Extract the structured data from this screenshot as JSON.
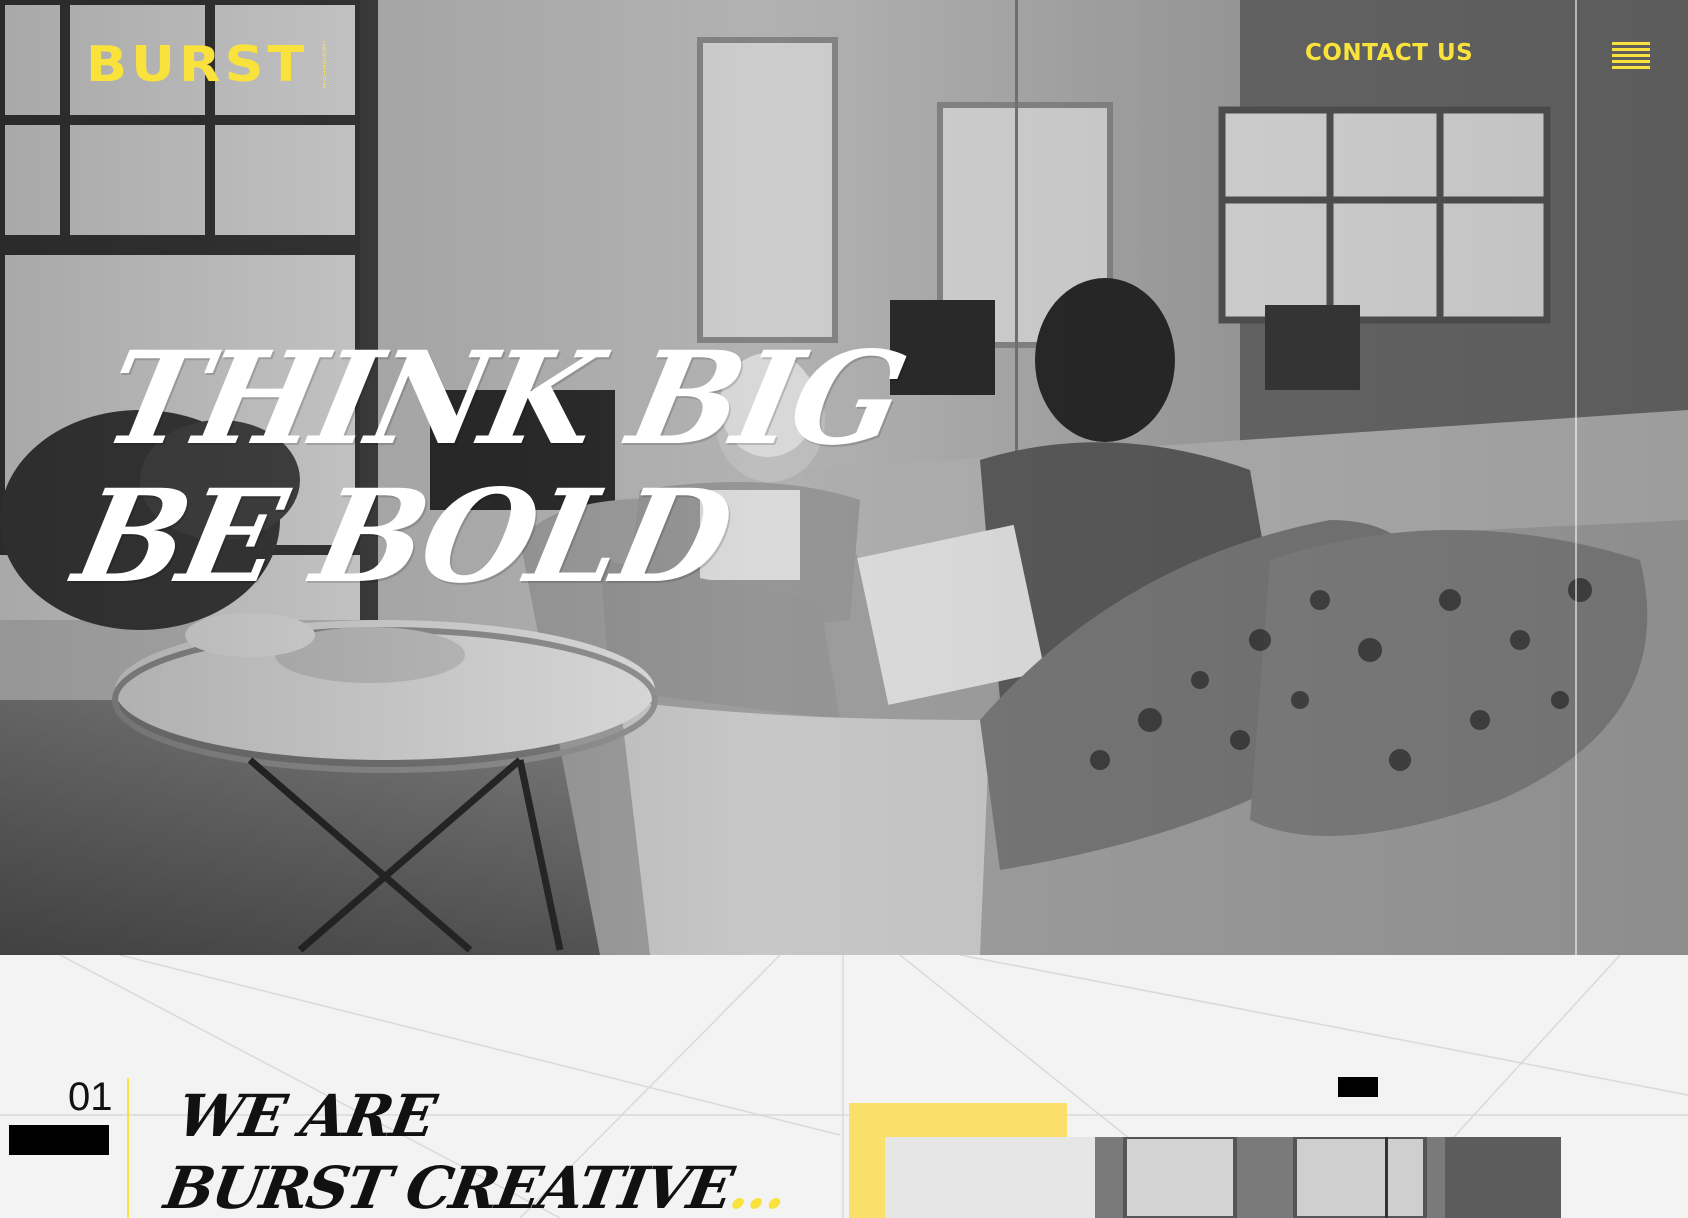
{
  "brand": {
    "logo_text": "BURST",
    "logo_sub": [
      "C",
      "R",
      "E",
      "A",
      "T",
      "I",
      "V",
      "E"
    ]
  },
  "nav": {
    "contact_label": "CONTACT US",
    "menu_icon": "hamburger-icon"
  },
  "hero": {
    "headline_line1": "THINK BIG",
    "headline_line2": "BE BOLD"
  },
  "intro": {
    "section_number": "01",
    "title_line1": "WE ARE",
    "title_line2": "BURST CREATIVE",
    "title_dots": "..."
  },
  "colors": {
    "accent": "#f9e23c",
    "accent_block": "#fadf6b",
    "background": "#f3f3f3",
    "text": "#111111"
  }
}
